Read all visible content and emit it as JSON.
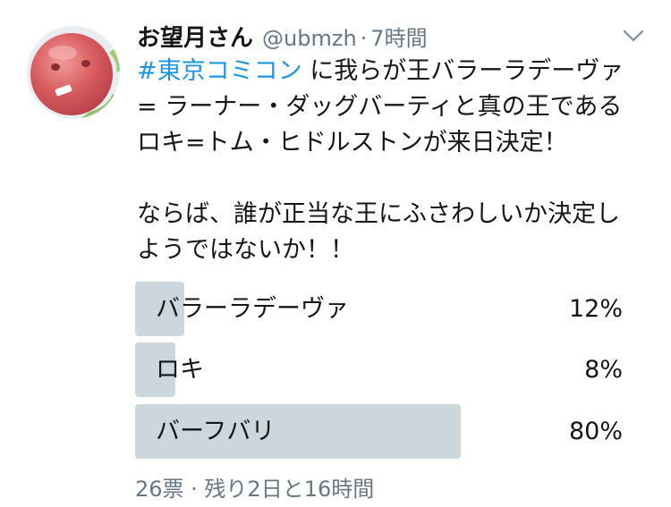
{
  "tweet": {
    "author_name": "お望月さん",
    "handle": "@ubmzh",
    "separator": "·",
    "time": "7時間",
    "hashtag": "#東京コミコン",
    "text_line1": " に我らが王バラーラデーヴァ",
    "text_line2": "= ラーナー・ダッグバーティと真の王である",
    "text_line3": "ロキ=トム・ヒドルストンが来日決定！",
    "text_line4": "ならば、誰が正当な王にふさわしいか決定し",
    "text_line5": "ようではないか！！"
  },
  "poll": {
    "options": [
      {
        "label": "バラーラデーヴァ",
        "percent_text": "12%",
        "fraction": 0.12
      },
      {
        "label": "ロキ",
        "percent_text": "8%",
        "fraction": 0.08
      },
      {
        "label": "バーフバリ",
        "percent_text": "80%",
        "fraction": 0.8
      }
    ],
    "meta": "26票 · 残り2日と16時間"
  },
  "colors": {
    "hashtag": "#1b95e0",
    "secondary_text": "#657786",
    "poll_bar": "#ccd6dd"
  },
  "icons": {
    "avatar": "tomato-face-avatar",
    "menu": "chevron-down-icon"
  }
}
